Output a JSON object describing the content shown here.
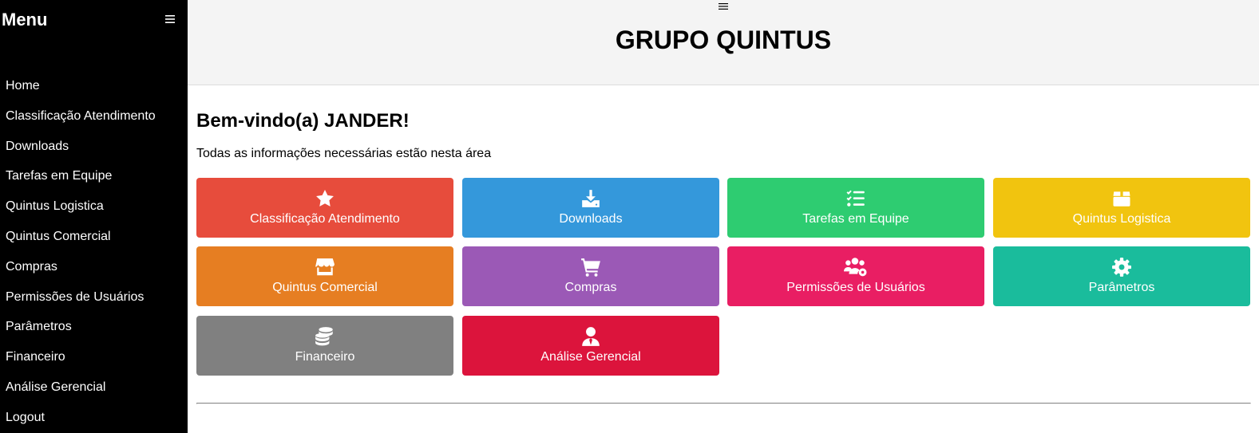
{
  "sidebar": {
    "title": "Menu",
    "toggle_icon": "hamburger-icon",
    "items": [
      {
        "label": "Home"
      },
      {
        "label": "Classificação Atendimento"
      },
      {
        "label": "Downloads"
      },
      {
        "label": "Tarefas em Equipe"
      },
      {
        "label": "Quintus Logistica"
      },
      {
        "label": "Quintus Comercial"
      },
      {
        "label": "Compras"
      },
      {
        "label": "Permissões de Usuários"
      },
      {
        "label": "Parâmetros"
      },
      {
        "label": "Financeiro"
      },
      {
        "label": "Análise Gerencial"
      },
      {
        "label": "Logout"
      }
    ]
  },
  "header": {
    "toggle_icon": "hamburger-icon",
    "title": "GRUPO QUINTUS"
  },
  "main": {
    "welcome": "Bem-vindo(a) JANDER!",
    "subtitle": "Todas as informações necessárias estão nesta área"
  },
  "tiles": [
    {
      "label": "Classificação Atendimento",
      "icon": "star-icon",
      "color": "#e74c3c"
    },
    {
      "label": "Downloads",
      "icon": "download-icon",
      "color": "#3498db"
    },
    {
      "label": "Tarefas em Equipe",
      "icon": "tasks-icon",
      "color": "#2ecc71"
    },
    {
      "label": "Quintus Logistica",
      "icon": "box-icon",
      "color": "#f1c40f"
    },
    {
      "label": "Quintus Comercial",
      "icon": "store-icon",
      "color": "#e67e22"
    },
    {
      "label": "Compras",
      "icon": "cart-icon",
      "color": "#9b59b6"
    },
    {
      "label": "Permissões de Usuários",
      "icon": "users-gear-icon",
      "color": "#e91e63"
    },
    {
      "label": "Parâmetros",
      "icon": "gear-icon",
      "color": "#1abc9c"
    },
    {
      "label": "Financeiro",
      "icon": "coins-icon",
      "color": "#808080"
    },
    {
      "label": "Análise Gerencial",
      "icon": "user-tie-icon",
      "color": "#dc143c"
    }
  ]
}
